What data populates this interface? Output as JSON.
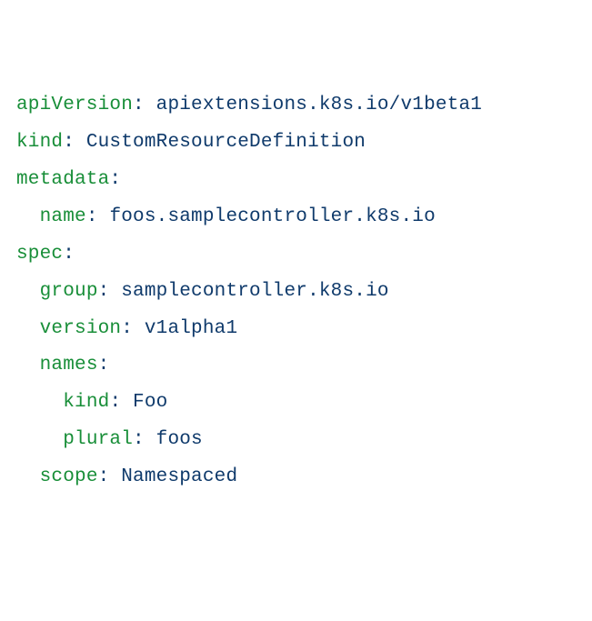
{
  "l0": {
    "key": "apiVersion",
    "sep": ": ",
    "value": "apiextensions.k8s.io/v1beta1"
  },
  "l1": {
    "key": "kind",
    "sep": ": ",
    "value": "CustomResourceDefinition"
  },
  "l2": {
    "key": "metadata",
    "sep": ":"
  },
  "l3": {
    "indent": "  ",
    "key": "name",
    "sep": ": ",
    "value": "foos.samplecontroller.k8s.io"
  },
  "l4": {
    "key": "spec",
    "sep": ":"
  },
  "l5": {
    "indent": "  ",
    "key": "group",
    "sep": ": ",
    "value": "samplecontroller.k8s.io"
  },
  "l6": {
    "indent": "  ",
    "key": "version",
    "sep": ": ",
    "value": "v1alpha1"
  },
  "l7": {
    "indent": "  ",
    "key": "names",
    "sep": ":"
  },
  "l8": {
    "indent": "    ",
    "key": "kind",
    "sep": ": ",
    "value": "Foo"
  },
  "l9": {
    "indent": "    ",
    "key": "plural",
    "sep": ": ",
    "value": "foos"
  },
  "l10": {
    "indent": "  ",
    "key": "scope",
    "sep": ": ",
    "value": "Namespaced"
  }
}
